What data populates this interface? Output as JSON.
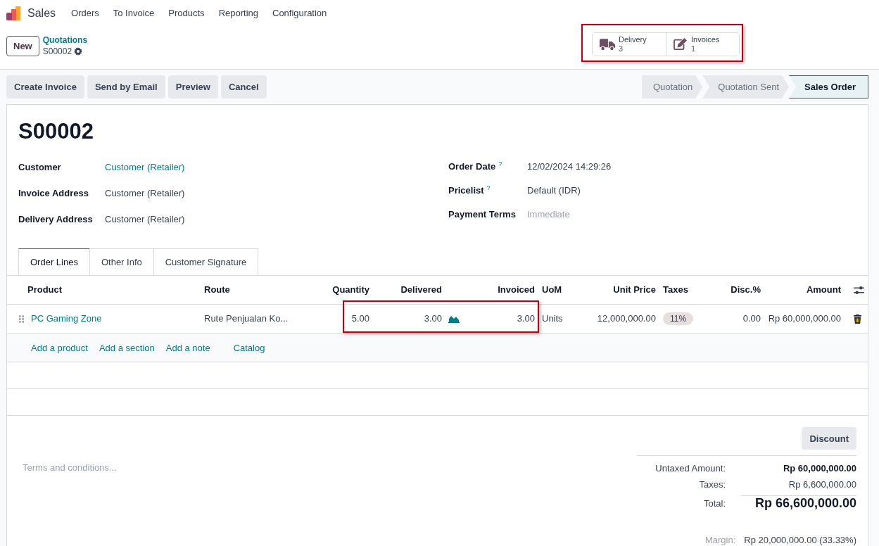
{
  "app": {
    "name": "Sales",
    "menu": [
      "Orders",
      "To Invoice",
      "Products",
      "Reporting",
      "Configuration"
    ]
  },
  "control_panel": {
    "new_button": "New",
    "breadcrumb": "Quotations",
    "record": "S00002"
  },
  "smart_buttons": [
    {
      "kind": "truck",
      "label": "Delivery",
      "count": "3"
    },
    {
      "kind": "edit",
      "label": "Invoices",
      "count": "1"
    }
  ],
  "actions": [
    "Create Invoice",
    "Send by Email",
    "Preview",
    "Cancel"
  ],
  "stages": [
    {
      "label": "Quotation",
      "selected": false
    },
    {
      "label": "Quotation Sent",
      "selected": false
    },
    {
      "label": "Sales Order",
      "selected": true
    }
  ],
  "form": {
    "title": "S00002",
    "left_fields": [
      {
        "label": "Customer",
        "value": "Customer (Retailer)",
        "link": true
      },
      {
        "label": "Invoice Address",
        "value": "Customer (Retailer)",
        "link": false
      },
      {
        "label": "Delivery Address",
        "value": "Customer (Retailer)",
        "link": false
      }
    ],
    "right_fields": [
      {
        "label": "Order Date",
        "help": "?",
        "value": "12/02/2024 14:29:26"
      },
      {
        "label": "Pricelist",
        "help": "?",
        "value": "Default (IDR)"
      },
      {
        "label": "Payment Terms",
        "placeholder": "Immediate"
      }
    ]
  },
  "tabs": [
    {
      "label": "Order Lines",
      "selected": true
    },
    {
      "label": "Other Info",
      "selected": false
    },
    {
      "label": "Customer Signature",
      "selected": false
    }
  ],
  "table": {
    "columns": [
      "Product",
      "Route",
      "Quantity",
      "Delivered",
      "Invoiced",
      "UoM",
      "Unit Price",
      "Taxes",
      "Disc.%",
      "Amount"
    ],
    "rows": [
      {
        "product": "PC Gaming Zone",
        "route": "Rute Penjualan Ko...",
        "quantity": "5.00",
        "delivered": "3.00",
        "invoiced": "3.00",
        "uom": "Units",
        "unit_price": "12,000,000.00",
        "tax": "11%",
        "discount": "0.00",
        "amount": "Rp 60,000,000.00"
      }
    ],
    "add_links": [
      "Add a product",
      "Add a section",
      "Add a note",
      "Catalog"
    ]
  },
  "terms": {
    "placeholder": "Terms and conditions..."
  },
  "discount_button": "Discount",
  "totals": [
    {
      "kind": "untaxed",
      "label": "Untaxed Amount:",
      "value": "Rp 60,000,000.00"
    },
    {
      "kind": "taxes",
      "label": "Taxes:",
      "value": "Rp 6,600,000.00"
    },
    {
      "kind": "total",
      "label": "Total:",
      "value": "Rp 66,600,000.00"
    }
  ],
  "margin": {
    "label": "Margin:",
    "value": "Rp 20,000,000.00 (33.33%)"
  }
}
